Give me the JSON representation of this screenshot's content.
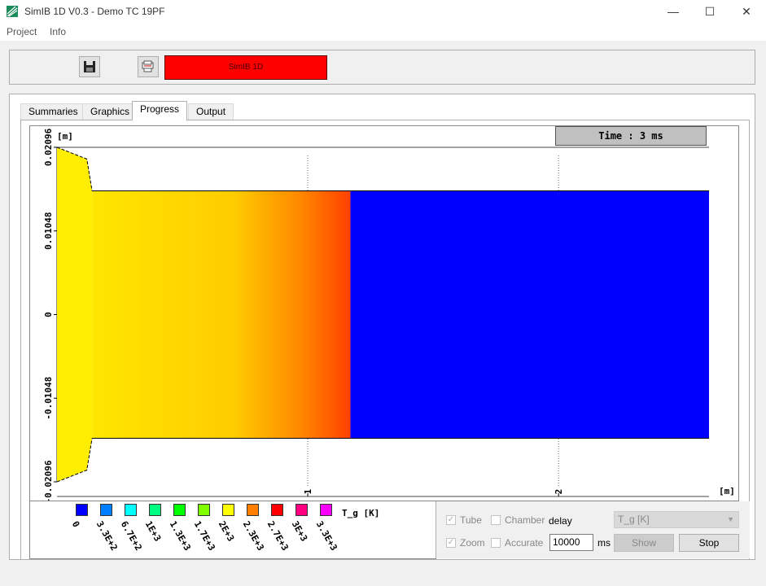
{
  "window": {
    "title": "SimIB 1D V0.3 - Demo TC 19PF",
    "minimize": "—",
    "maximize": "☐",
    "close": "✕"
  },
  "menu": {
    "items": [
      "Project",
      "Info"
    ]
  },
  "toolbar": {
    "run_label": "SimIB 1D",
    "save_icon": "save-icon",
    "print_icon": "print-icon"
  },
  "tabs": [
    "Summaries",
    "Graphics",
    "Progress",
    "Output"
  ],
  "active_tab": "Progress",
  "plot": {
    "time_label": "Time : 3 ms",
    "y_unit": "[m]",
    "x_unit": "[m]",
    "y_ticks": [
      "0.02096",
      "0.01048",
      "0",
      "-0.01048",
      "-0.02096"
    ],
    "x_ticks": [
      "1",
      "2"
    ],
    "x_range": [
      0,
      2.6
    ],
    "y_range": [
      -0.02096,
      0.02096
    ],
    "tube_radius": 0.0155,
    "chamber_end_x": 0.14,
    "hot_front_x": 1.17,
    "colors": {
      "yellow": "#ffee00",
      "orange": "#ff8800",
      "red_orange": "#ff4400",
      "blue": "#0000ff"
    }
  },
  "legend": {
    "title": "T_g [K]",
    "items": [
      {
        "label": "0",
        "color": "#0000ff"
      },
      {
        "label": "3.3E+2",
        "color": "#0080ff"
      },
      {
        "label": "6.7E+2",
        "color": "#00ffff"
      },
      {
        "label": "1E+3",
        "color": "#00ff80"
      },
      {
        "label": "1.3E+3",
        "color": "#00ff00"
      },
      {
        "label": "1.7E+3",
        "color": "#80ff00"
      },
      {
        "label": "2E+3",
        "color": "#ffff00"
      },
      {
        "label": "2.3E+3",
        "color": "#ff8000"
      },
      {
        "label": "2.7E+3",
        "color": "#ff0000"
      },
      {
        "label": "3E+3",
        "color": "#ff0080"
      },
      {
        "label": "3.3E+3",
        "color": "#ff00ff"
      }
    ]
  },
  "controls": {
    "tube_label": "Tube",
    "tube_checked": true,
    "chamber_label": "Chamber",
    "chamber_checked": false,
    "delay_label": "delay",
    "zoom_label": "Zoom",
    "zoom_checked": true,
    "accurate_label": "Accurate",
    "accurate_checked": false,
    "delay_value": "10000",
    "delay_unit": "ms",
    "variable_select": "T_g [K]",
    "show_label": "Show",
    "stop_label": "Stop"
  }
}
